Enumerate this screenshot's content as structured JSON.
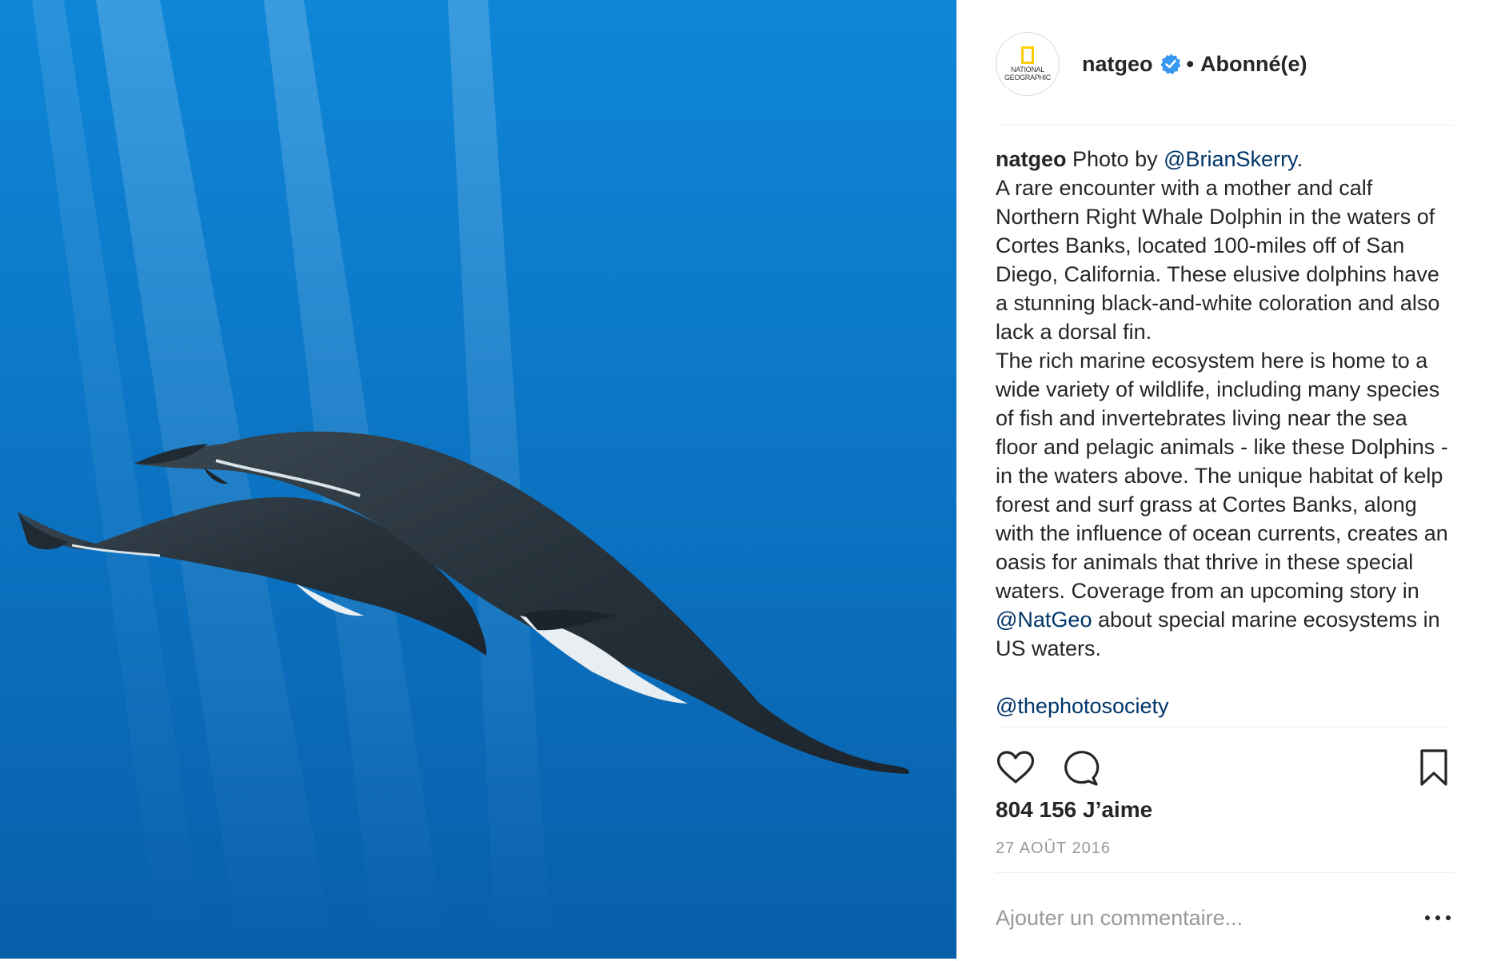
{
  "post": {
    "photo_alt": "",
    "author": {
      "username": "natgeo",
      "avatar_text_line1": "NATIONAL",
      "avatar_text_line2": "GEOGRAPHIC",
      "verified": true,
      "separator": "•",
      "follow_status": "Abonné(e)"
    },
    "caption": {
      "username": "natgeo",
      "intro": " Photo by ",
      "credit_mention": "@BrianSkerry",
      "credit_end": ".",
      "paragraph1": "A rare encounter with a mother and calf Northern Right Whale Dolphin in the waters of Cortes Banks, located 100-miles off of San Diego, California. These elusive dolphins have a stunning black-and-white coloration and also lack a dorsal fin.",
      "paragraph2_start": "The rich marine ecosystem here is home to a wide variety of wildlife, including many species of fish and invertebrates living near the sea floor and pelagic animals - like these Dolphins - in the waters above. The unique habitat of kelp forest and surf grass at Cortes Banks, along with the influence of ocean currents, creates an oasis for animals that thrive in these special waters. Coverage from an upcoming story in ",
      "paragraph2_mention": "@NatGeo",
      "paragraph2_end": " about special marine ecosystems in US waters.",
      "society_mention": "@thephotosociety"
    },
    "actions": {
      "like_icon": "heart-outline-icon",
      "comment_icon": "speech-bubble-icon",
      "save_icon": "bookmark-icon"
    },
    "likes_text": "804 156 J’aime",
    "date_text": "27 AOÛT 2016",
    "comment": {
      "placeholder": "Ajouter un commentaire...",
      "value": ""
    },
    "more_icon": "more-options-icon"
  },
  "colors": {
    "link": "#003569",
    "verified_badge": "#3897f0",
    "ocean_top": "#0f86d8",
    "ocean_bottom": "#085fa9"
  }
}
